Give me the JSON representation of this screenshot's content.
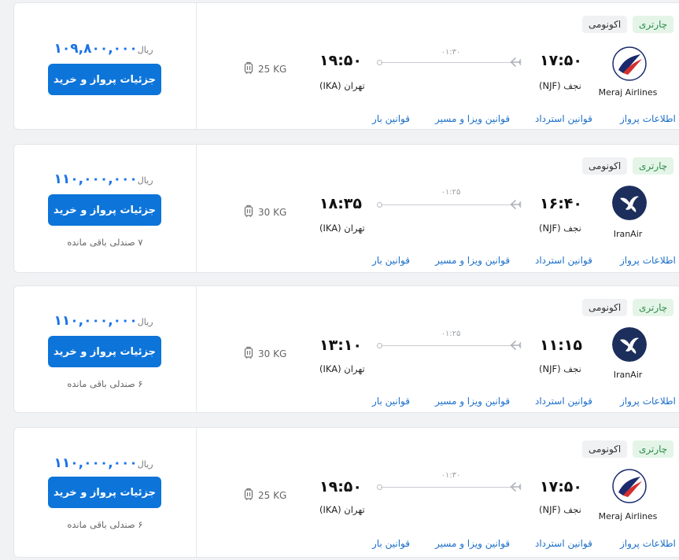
{
  "flights": [
    {
      "badge_type": "چارتری",
      "badge_class": "اکونومی",
      "airline": "Meraj Airlines",
      "logo": "meraj-logo",
      "dep_time": "۱۷:۵۰",
      "dep_city": "نجف (NJF)",
      "arr_time": "۱۹:۵۰",
      "arr_city": "تهران (IKA)",
      "duration": "۰۱:۳۰",
      "baggage": "25 KG",
      "price": "۱۰۹,۸۰۰,۰۰۰",
      "currency": "ریال",
      "button": "جزئیات پرواز و خرید",
      "seats": "",
      "links": [
        "اطلاعات پرواز",
        "قوانین استرداد",
        "قوانین ویزا و مسیر",
        "قوانین بار"
      ]
    },
    {
      "badge_type": "چارتری",
      "badge_class": "اکونومی",
      "airline": "IranAir",
      "logo": "iranair-logo",
      "dep_time": "۱۶:۴۰",
      "dep_city": "نجف (NJF)",
      "arr_time": "۱۸:۳۵",
      "arr_city": "تهران (IKA)",
      "duration": "۰۱:۲۵",
      "baggage": "30 KG",
      "price": "۱۱۰,۰۰۰,۰۰۰",
      "currency": "ریال",
      "button": "جزئیات پرواز و خرید",
      "seats": "۷ صندلی باقی مانده",
      "links": [
        "اطلاعات پرواز",
        "قوانین استرداد",
        "قوانین ویزا و مسیر",
        "قوانین بار"
      ]
    },
    {
      "badge_type": "چارتری",
      "badge_class": "اکونومی",
      "airline": "IranAir",
      "logo": "iranair-logo",
      "dep_time": "۱۱:۱۵",
      "dep_city": "نجف (NJF)",
      "arr_time": "۱۳:۱۰",
      "arr_city": "تهران (IKA)",
      "duration": "۰۱:۲۵",
      "baggage": "30 KG",
      "price": "۱۱۰,۰۰۰,۰۰۰",
      "currency": "ریال",
      "button": "جزئیات پرواز و خرید",
      "seats": "۶ صندلی باقی مانده",
      "links": [
        "اطلاعات پرواز",
        "قوانین استرداد",
        "قوانین ویزا و مسیر",
        "قوانین بار"
      ]
    },
    {
      "badge_type": "چارتری",
      "badge_class": "اکونومی",
      "airline": "Meraj Airlines",
      "logo": "meraj-logo",
      "dep_time": "۱۷:۵۰",
      "dep_city": "نجف (NJF)",
      "arr_time": "۱۹:۵۰",
      "arr_city": "تهران (IKA)",
      "duration": "۰۱:۳۰",
      "baggage": "25 KG",
      "price": "۱۱۰,۰۰۰,۰۰۰",
      "currency": "ریال",
      "button": "جزئیات پرواز و خرید",
      "seats": "۶ صندلی باقی مانده",
      "links": [
        "اطلاعات پرواز",
        "قوانین استرداد",
        "قوانین ویزا و مسیر",
        "قوانین بار"
      ]
    }
  ],
  "colors": {
    "accent": "#0d74d9",
    "price": "#1a73e8",
    "link": "#1a6fc9",
    "charter_bg": "#e4f5e8",
    "charter_text": "#2e8b4a"
  }
}
